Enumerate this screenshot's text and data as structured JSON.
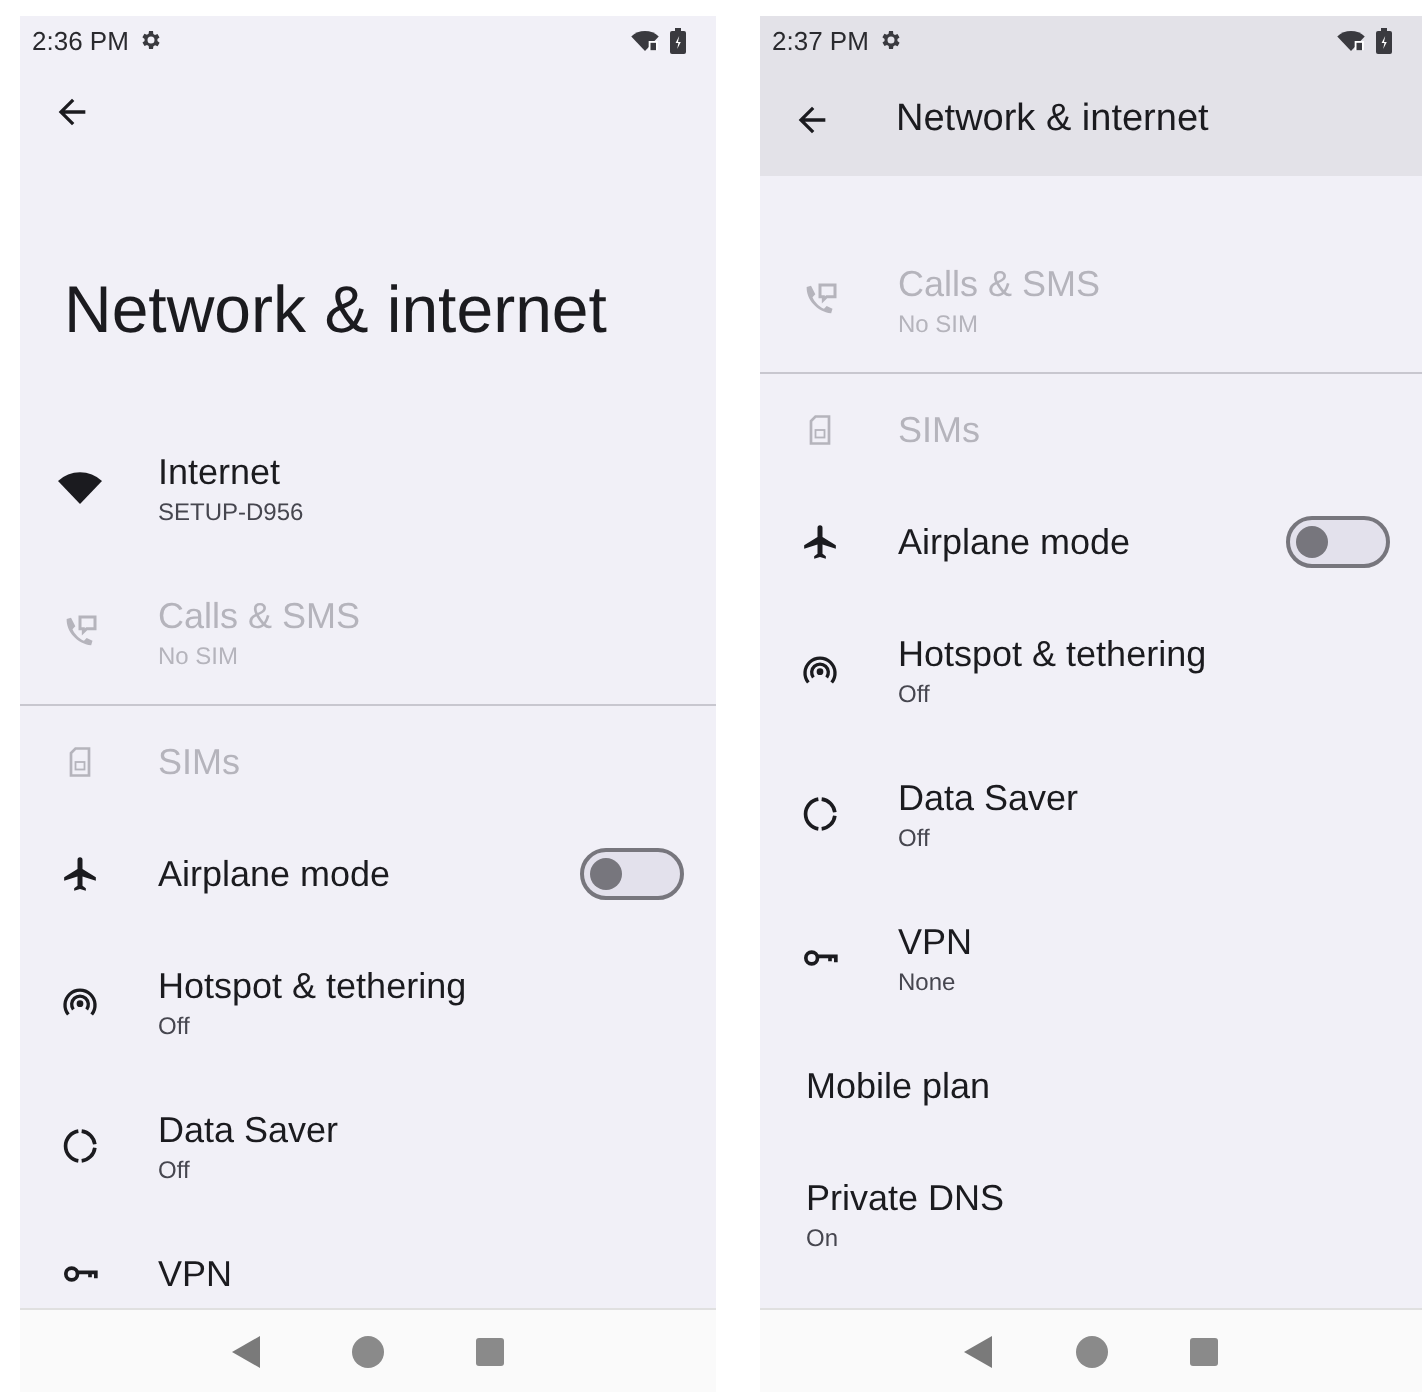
{
  "screens": [
    {
      "status_bar": {
        "time": "2:36 PM"
      },
      "header": {
        "kind": "large",
        "title": "Network & internet"
      },
      "items": [
        {
          "kind": "wifi",
          "title": "Internet",
          "summary": "SETUP-D956",
          "disabled": false
        },
        {
          "kind": "calls",
          "title": "Calls & SMS",
          "summary": "No SIM",
          "disabled": true
        },
        {
          "kind": "divider"
        },
        {
          "kind": "sim",
          "title": "SIMs",
          "disabled": true
        },
        {
          "kind": "airplane",
          "title": "Airplane mode",
          "disabled": false,
          "on": false
        },
        {
          "kind": "hotspot",
          "title": "Hotspot & tethering",
          "summary": "Off",
          "disabled": false
        },
        {
          "kind": "datasaver",
          "title": "Data Saver",
          "summary": "Off",
          "disabled": false
        },
        {
          "kind": "vpn",
          "title": "VPN",
          "disabled": false
        }
      ]
    },
    {
      "status_bar": {
        "time": "2:37 PM"
      },
      "header": {
        "kind": "bar",
        "title": "Network & internet"
      },
      "items": [
        {
          "kind": "calls",
          "title": "Calls & SMS",
          "summary": "No SIM",
          "disabled": true
        },
        {
          "kind": "divider"
        },
        {
          "kind": "sim",
          "title": "SIMs",
          "disabled": true
        },
        {
          "kind": "airplane",
          "title": "Airplane mode",
          "disabled": false,
          "on": false
        },
        {
          "kind": "hotspot",
          "title": "Hotspot & tethering",
          "summary": "Off",
          "disabled": false
        },
        {
          "kind": "datasaver",
          "title": "Data Saver",
          "summary": "Off",
          "disabled": false
        },
        {
          "kind": "vpn",
          "title": "VPN",
          "summary": "None",
          "disabled": false
        },
        {
          "kind": "plain",
          "title": "Mobile plan",
          "disabled": false
        },
        {
          "kind": "plain",
          "title": "Private DNS",
          "summary": "On",
          "disabled": false
        }
      ]
    }
  ]
}
